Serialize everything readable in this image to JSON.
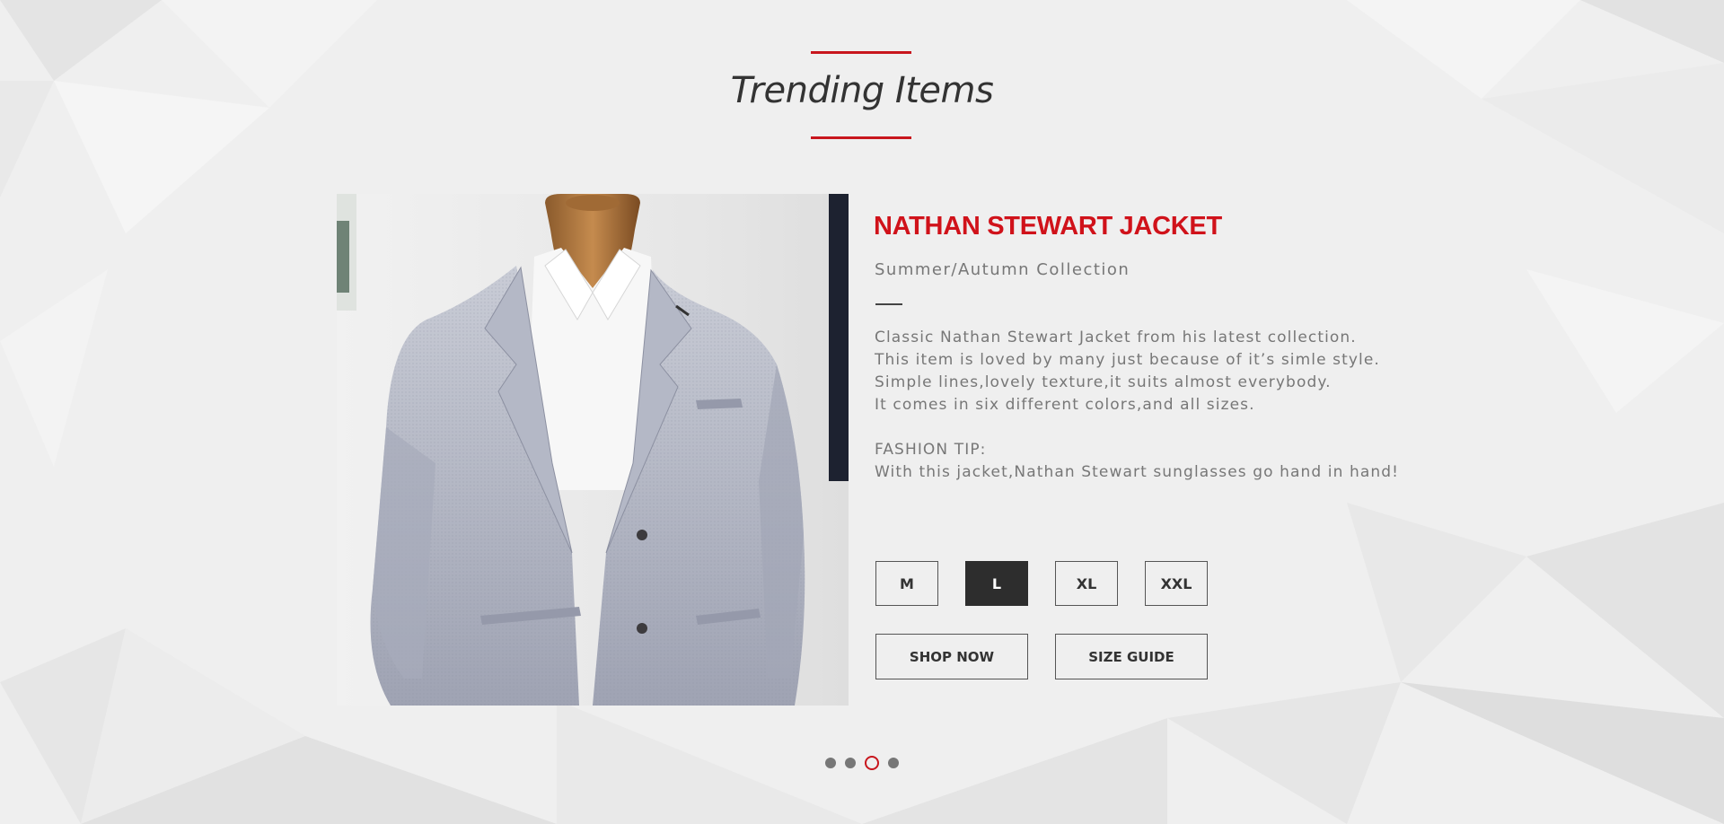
{
  "section": {
    "title": "Trending Items",
    "accent_color": "#c8161d"
  },
  "product": {
    "name": "NATHAN STEWART JACKET",
    "collection": "Summer/Autumn Collection",
    "description": [
      "Classic Nathan Stewart Jacket from his latest collection.",
      "This item is loved by many just because of it’s simle style.",
      "Simple lines,lovely texture,it suits almost everybody.",
      "It comes in six different colors,and all sizes."
    ],
    "tip_label": "FASHION TIP:",
    "tip_text": "With this jacket,Nathan Stewart sunglasses go hand in hand!",
    "name_color": "#d0121a",
    "image_icon": "jacket-photo"
  },
  "sizes": {
    "options": [
      "M",
      "L",
      "XL",
      "XXL"
    ],
    "selected": "L"
  },
  "actions": {
    "shop_now_label": "SHOP NOW",
    "size_guide_label": "SIZE GUIDE"
  },
  "pager": {
    "count": 4,
    "active_index": 3
  }
}
